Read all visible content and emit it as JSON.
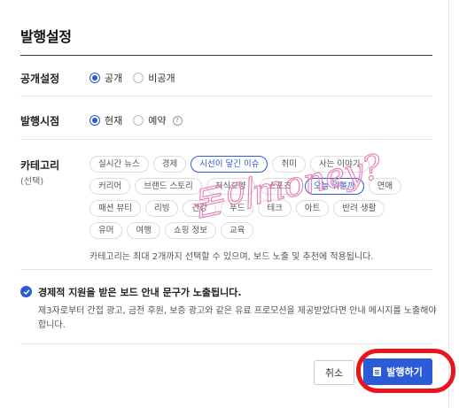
{
  "dialog": {
    "title": "발행설정"
  },
  "visibility": {
    "label": "공개설정",
    "options": [
      {
        "label": "공개",
        "selected": true
      },
      {
        "label": "비공개",
        "selected": false
      }
    ]
  },
  "publish_time": {
    "label": "발행시점",
    "options": [
      {
        "label": "현재",
        "selected": true
      },
      {
        "label": "예약",
        "selected": false
      }
    ],
    "help_glyph": "?"
  },
  "category": {
    "label": "카테고리",
    "sublabel": "(선택)",
    "chips": [
      {
        "label": "실시간 뉴스",
        "selected": false
      },
      {
        "label": "경제",
        "selected": false
      },
      {
        "label": "시선이 닿긴 이슈",
        "selected": true
      },
      {
        "label": "취미",
        "selected": false
      },
      {
        "label": "사는 이야기",
        "selected": false
      },
      {
        "label": "커리어",
        "selected": false
      },
      {
        "label": "브랜드 스토리",
        "selected": false
      },
      {
        "label": "지식교양",
        "selected": false
      },
      {
        "label": "스포츠",
        "selected": false
      },
      {
        "label": "오늘 뭐볼까",
        "selected": true
      },
      {
        "label": "연애",
        "selected": false
      },
      {
        "label": "패션 뷰티",
        "selected": false
      },
      {
        "label": "리빙",
        "selected": false
      },
      {
        "label": "건강",
        "selected": false
      },
      {
        "label": "푸드",
        "selected": false
      },
      {
        "label": "테크",
        "selected": false
      },
      {
        "label": "아트",
        "selected": false
      },
      {
        "label": "반려 생활",
        "selected": false
      },
      {
        "label": "유머",
        "selected": false
      },
      {
        "label": "여행",
        "selected": false
      },
      {
        "label": "쇼핑 정보",
        "selected": false
      },
      {
        "label": "교육",
        "selected": false
      }
    ],
    "hint": "카테고리는 최대 2개까지 선택할 수 있으며, 보드 노출 및 추천에 적용됩니다."
  },
  "sponsorship": {
    "checked": true,
    "title": "경제적 지원을 받은 보드 안내 문구가 노출됩니다.",
    "description": "제3자로부터 간접 광고, 금전 후원, 보증 광고와 같은 유료 프로모션을 제공받았다면 안내 메시지를 노출해야 합니다."
  },
  "actions": {
    "cancel_label": "취소",
    "publish_label": "발행하기"
  },
  "overlay": {
    "handwriting": "돈이money?",
    "handwriting_color": "#e77ab0",
    "highlight_color": "#e8141e"
  },
  "colors": {
    "accent": "#2b5bd7"
  }
}
